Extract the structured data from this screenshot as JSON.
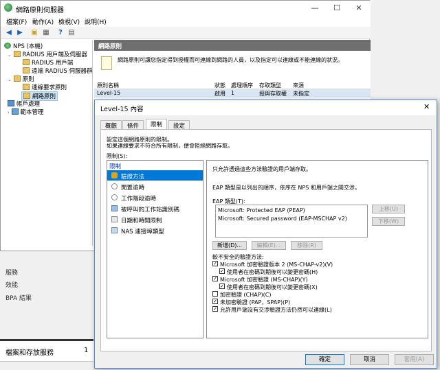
{
  "window": {
    "title": "網路原則伺服器",
    "minimize": "—",
    "maximize": "☐",
    "close": "✕"
  },
  "menu": [
    "檔案(F)",
    "動作(A)",
    "檢視(V)",
    "說明(H)"
  ],
  "tree": {
    "root": "NPS (本機)",
    "radius": "RADIUS 用戶端及伺服器",
    "radius_client": "RADIUS 用戶端",
    "remote_group": "遠端 RADIUS 伺服器群",
    "policies": "原則",
    "connection_policy": "連線要求原則",
    "network_policy": "網路原則",
    "accounting": "帳戶處理",
    "templates": "範本管理"
  },
  "right_pane": {
    "header": "網路原則",
    "description": "網路原則可讓您指定得到授權而可連線到網路的人員，以及指定可以連線或不能連線的狀況。",
    "columns": [
      "原則名稱",
      "狀態",
      "處理順序",
      "存取類型",
      "來源"
    ],
    "row": [
      "Level-15",
      "啟用",
      "1",
      "授與存取權",
      "未指定"
    ]
  },
  "side_strip": {
    "items": [
      "服務",
      "效能",
      "BPA 結果"
    ],
    "tile_label": "檔案和存放服務",
    "tile_count": "1"
  },
  "dialog": {
    "title": "Level-15 內容",
    "close": "✕",
    "tabs": [
      "概觀",
      "條件",
      "限制",
      "設定"
    ],
    "intro_1": "設定這個網路原則的限制。",
    "intro_2": "如果連線要求不符合所有限制，便會拒絕網路存取。",
    "restrictions_label": "限制(S):",
    "list_header": "限制",
    "list_items": [
      "驗證方法",
      "閒置逾時",
      "工作階段逾時",
      "被呼叫的工作站識別碼",
      "日期和時間限制",
      "NAS 連接埠類型"
    ],
    "content": {
      "allow_text": "只允許透過這些方法驗證的用戶端存取。",
      "eap_desc": "EAP 類型是以列出的順序，依序在 NPS 和用戶端之間交涉。",
      "eap_label": "EAP 類型(T):",
      "eap_items": [
        "Microsoft: Protected EAP (PEAP)",
        "Microsoft: Secured password (EAP-MSCHAP v2)"
      ],
      "move_up": "上移(U)",
      "move_down": "下移(W)",
      "add": "新增(D)...",
      "edit": "編輯(E)...",
      "remove": "移除(R)",
      "less_secure": "較不安全的驗證方法:",
      "checks": [
        {
          "label": "Microsoft 加密驗證版本 2 (MS-CHAP-v2)(V)",
          "checked": true
        },
        {
          "label": "使用者在密碼到期後可以變更密碼(H)",
          "checked": true
        },
        {
          "label": "Microsoft 加密驗證 (MS-CHAP)(Y)",
          "checked": true
        },
        {
          "label": "使用者在密碼到期後可以變更密碼(X)",
          "checked": true
        },
        {
          "label": "加密驗證 (CHAP)(C)",
          "checked": false
        },
        {
          "label": "未加密驗證 (PAP，SPAP)(P)",
          "checked": true
        },
        {
          "label": "允許用戶端沒有交涉驗證方法仍然可以連線(L)",
          "checked": true
        }
      ]
    },
    "ok": "確定",
    "cancel": "取消",
    "apply": "套用(A)"
  }
}
